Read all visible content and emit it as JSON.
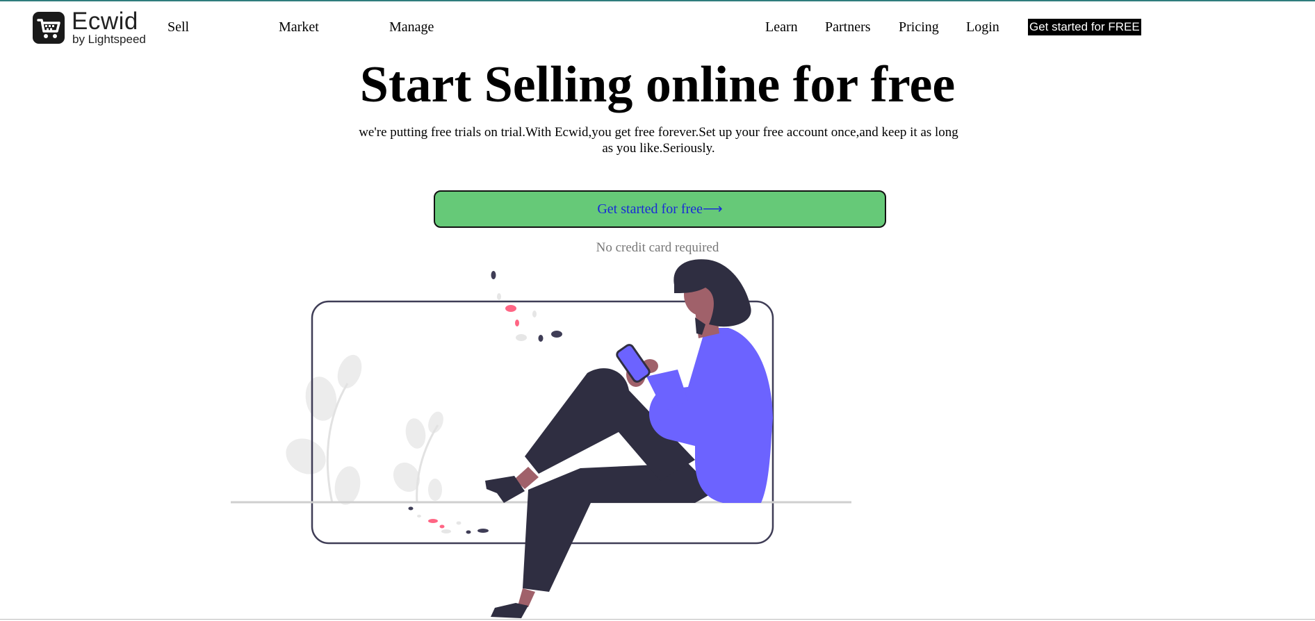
{
  "brand": {
    "name": "Ecwid",
    "tagline": "by Lightspeed"
  },
  "nav": {
    "sell": "Sell",
    "market": "Market",
    "manage": "Manage",
    "learn": "Learn",
    "partners": "Partners",
    "pricing": "Pricing",
    "login": "Login",
    "cta": "Get started for FREE"
  },
  "hero": {
    "headline": "Start Selling online for free",
    "subtitle": "we're putting free trials on trial.With Ecwid,you get free forever.Set up your free account once,and keep it as long as you like.Seriously.",
    "cta": "Get started for free⟶",
    "note": "No credit card required"
  },
  "colors": {
    "cta_green": "#66c978",
    "cta_text": "#1a2bd6",
    "accent_purple": "#6c63ff",
    "dark": "#2f2e41",
    "pink": "#ff6584",
    "skin": "#a0616a"
  },
  "icons": {
    "logo": "shopping-cart-icon"
  }
}
